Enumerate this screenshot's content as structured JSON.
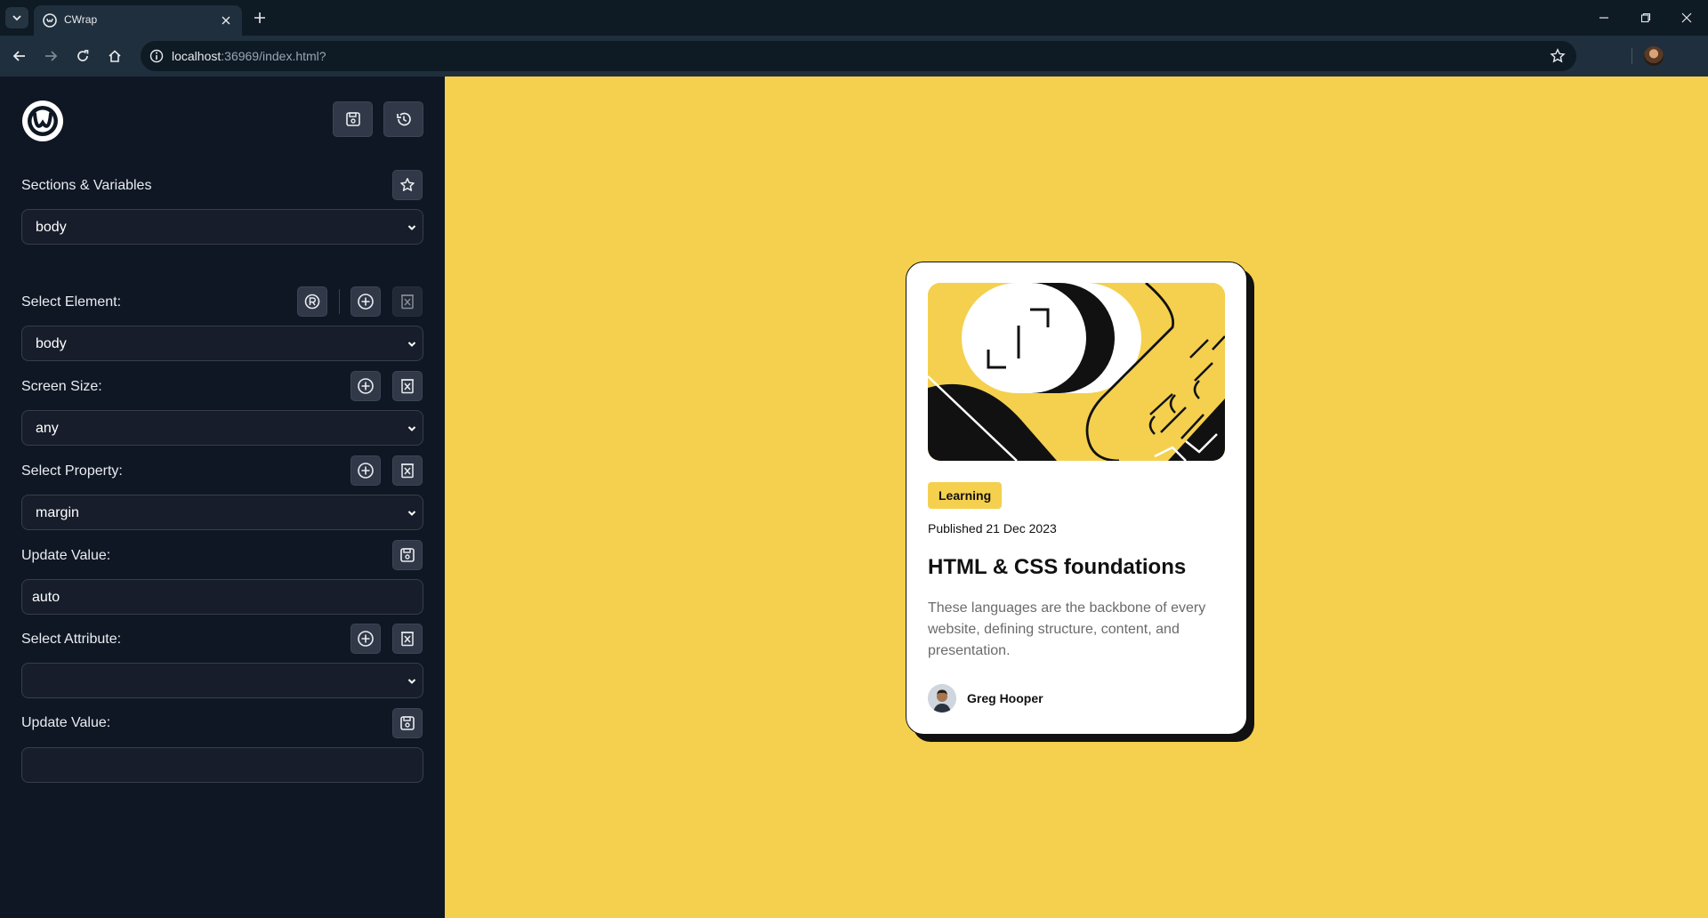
{
  "browser": {
    "tab_title": "CWrap",
    "url_host": "localhost",
    "url_rest": ":36969/index.html?"
  },
  "editor": {
    "sections": {
      "label": "Sections & Variables",
      "value": "body"
    },
    "element": {
      "label": "Select Element:",
      "value": "body"
    },
    "screen": {
      "label": "Screen Size:",
      "value": "any"
    },
    "property": {
      "label": "Select Property:",
      "value": "margin"
    },
    "property_value": {
      "label": "Update Value:",
      "value": "auto"
    },
    "attribute": {
      "label": "Select Attribute:",
      "value": ""
    },
    "attribute_value": {
      "label": "Update Value:",
      "value": ""
    }
  },
  "card": {
    "tag": "Learning",
    "published": "Published 21 Dec 2023",
    "title": "HTML & CSS foundations",
    "description": "These languages are the backbone of every website, defining structure, content, and presentation.",
    "author": "Greg Hooper"
  },
  "colors": {
    "panel_bg": "#0f1724",
    "preview_bg": "#f4d04e",
    "card_bg": "#ffffff",
    "ink": "#111111"
  }
}
